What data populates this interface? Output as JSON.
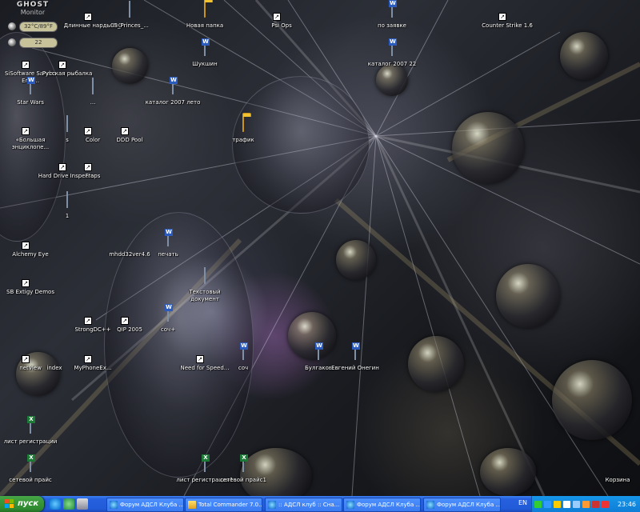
{
  "ghost_monitor": {
    "title": "GHOST",
    "subtitle": "Monitor",
    "readings": [
      "32°C/89°F",
      "22"
    ]
  },
  "desktop_icons": [
    {
      "label": "SiSoftware Sandra Engi...",
      "icon": "sandra-icon",
      "kind": "exe-teal"
    },
    {
      "label": "Русская рыбалка",
      "icon": "fishing-game-icon",
      "kind": "exe-blue"
    },
    {
      "label": "Star Wars",
      "icon": "word-doc-icon",
      "kind": "word"
    },
    {
      "label": "«Большая энциклопе...",
      "icon": "encyclopedia-icon",
      "kind": "exe-enc"
    },
    {
      "label": "s",
      "icon": "document-icon",
      "kind": "img"
    },
    {
      "label": "Hard Drive Inspector",
      "icon": "hdd-inspector-icon",
      "kind": "exe-hdd"
    },
    {
      "label": "1",
      "icon": "document-icon",
      "kind": "img"
    },
    {
      "label": "Alchemy Eye",
      "icon": "alchemy-eye-icon",
      "kind": "exe-alch"
    },
    {
      "label": "SB Extigy Demos",
      "icon": "sb-extigy-icon",
      "kind": "exe-sb"
    },
    {
      "label": "netview",
      "icon": "netview-icon",
      "kind": "exe-net"
    },
    {
      "label": "лист регистрации",
      "icon": "excel-doc-icon",
      "kind": "excel"
    },
    {
      "label": "сетевой прайс",
      "icon": "excel-doc-icon",
      "kind": "excel"
    },
    {
      "label": "Длинные нарды 2.0",
      "icon": "backgammon-icon",
      "kind": "exe-nardy"
    },
    {
      "label": "09_Princes_...",
      "icon": "audio-file-icon",
      "kind": "audio"
    },
    {
      "label": "...",
      "icon": "document-icon",
      "kind": "plain"
    },
    {
      "label": "Color",
      "icon": "color-icon",
      "kind": "exe-color"
    },
    {
      "label": "Fraps",
      "icon": "fraps-icon",
      "kind": "exe-fraps"
    },
    {
      "label": "DDD Pool",
      "icon": "pool-game-icon",
      "kind": "exe-pool"
    },
    {
      "label": "каталог 2007 лето",
      "icon": "word-doc-icon",
      "kind": "word"
    },
    {
      "label": "mhdd32ver4.6",
      "icon": "cd-image-icon",
      "kind": "cd"
    },
    {
      "label": "печать",
      "icon": "word-doc-icon",
      "kind": "word"
    },
    {
      "label": "StrongDC++",
      "icon": "strongdc-icon",
      "kind": "exe-dc"
    },
    {
      "label": "QIP 2005",
      "icon": "qip-icon",
      "kind": "exe-qip"
    },
    {
      "label": "соч+",
      "icon": "word-doc-icon",
      "kind": "word"
    },
    {
      "label": "index",
      "icon": "ie-icon",
      "kind": "exe-ie"
    },
    {
      "label": "MyPhoneEx...",
      "icon": "myphone-icon",
      "kind": "exe-phone"
    },
    {
      "label": "Новая папка",
      "icon": "folder-icon",
      "kind": "folder"
    },
    {
      "label": "Шукшин",
      "icon": "word-doc-icon",
      "kind": "word"
    },
    {
      "label": "трафик",
      "icon": "folder-icon",
      "kind": "folder"
    },
    {
      "label": "Текстовый документ",
      "icon": "text-doc-icon",
      "kind": "plain"
    },
    {
      "label": "Need for Speed...",
      "icon": "nfs-icon",
      "kind": "exe-nfs"
    },
    {
      "label": "соч",
      "icon": "word-doc-icon",
      "kind": "word"
    },
    {
      "label": "лист регистрации1",
      "icon": "excel-doc-icon",
      "kind": "excel"
    },
    {
      "label": "сетевой прайс1",
      "icon": "excel-doc-icon",
      "kind": "excel"
    },
    {
      "label": "Psi Ops",
      "icon": "psi-ops-icon",
      "kind": "exe-psi"
    },
    {
      "label": "Булгаков",
      "icon": "word-doc-icon",
      "kind": "word"
    },
    {
      "label": "Евгений Онегин",
      "icon": "word-doc-icon",
      "kind": "word"
    },
    {
      "label": "по заявке",
      "icon": "word-doc-icon",
      "kind": "word"
    },
    {
      "label": "каталог 2007 22",
      "icon": "word-doc-icon",
      "kind": "word"
    },
    {
      "label": "Counter Strike 1.6",
      "icon": "counter-strike-icon",
      "kind": "exe-cs"
    },
    {
      "label": "Корзина",
      "icon": "recycle-bin-icon",
      "kind": "bin"
    }
  ],
  "taskbar": {
    "start_label": "пуск",
    "tasks": [
      {
        "label": "Форум АДСЛ Клуба ...",
        "icon": "ie-icon"
      },
      {
        "label": "Total Commander 7.0...",
        "icon": "total-commander-icon"
      },
      {
        "label": ":: АДСЛ клуб :: Сна...",
        "icon": "ie-icon"
      },
      {
        "label": "Форум АДСЛ Клуба ...",
        "icon": "ie-icon"
      },
      {
        "label": "Форум АДСЛ Клуба ...",
        "icon": "ie-icon"
      }
    ],
    "language": "EN",
    "clock": "23:46"
  },
  "colors": {
    "taskbar": "#245EDC",
    "start": "#3A9A3A",
    "tray": "#0F7DD6"
  }
}
